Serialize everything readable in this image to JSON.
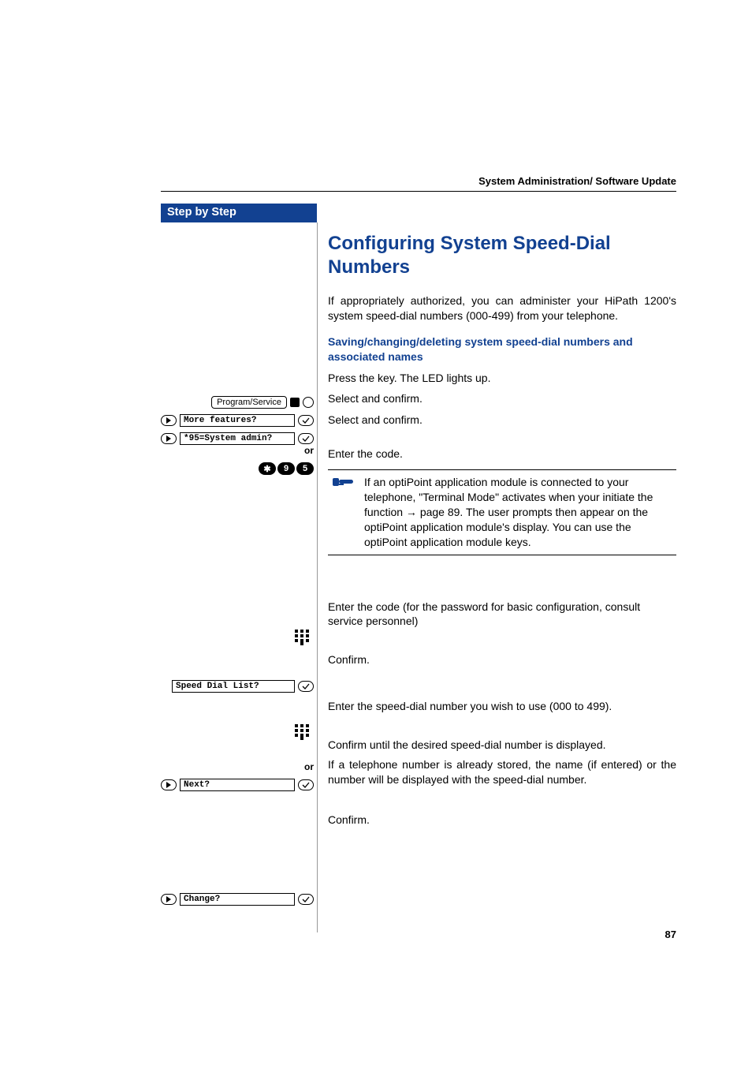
{
  "header": {
    "running_title": "System Administration/ Software Update"
  },
  "sidebar": {
    "banner": "Step by Step",
    "widgets": {
      "program_service": "Program/Service",
      "more_features": "More features?",
      "system_admin": "*95=System admin?",
      "or": "or",
      "code_keys": [
        "✱",
        "9",
        "5"
      ],
      "speed_dial_list": "Speed Dial List?",
      "next": "Next?",
      "change": "Change?"
    }
  },
  "content": {
    "h1": "Configuring System Speed-Dial Numbers",
    "intro": "If appropriately authorized, you can administer your HiPath 1200's system speed-dial numbers (000-499) from your telephone.",
    "subhead": "Saving/changing/deleting system speed-dial numbers and associated names",
    "steps": {
      "press_key": "Press the key. The LED lights up.",
      "select_confirm_1": "Select and confirm.",
      "select_confirm_2": "Select and confirm.",
      "enter_code": "Enter the code.",
      "note": "If an optiPoint application module is connected to your telephone, \"Terminal Mode\" activates when your initiate the function → page 89. The user prompts then appear on the optiPoint application module's display. You can use the optiPoint application module keys.",
      "enter_password": "Enter the code (for the password for basic configuration, consult service personnel)",
      "confirm_1": "Confirm.",
      "enter_speed_dial": "Enter the speed-dial number you wish to use (000 to 499).",
      "or": "or",
      "confirm_until": "Confirm until the desired speed-dial number is displayed.",
      "already_stored": "If a telephone number is already stored, the name (if entered) or the number will be displayed with the speed-dial number.",
      "confirm_2": "Confirm."
    }
  },
  "page_number": "87"
}
